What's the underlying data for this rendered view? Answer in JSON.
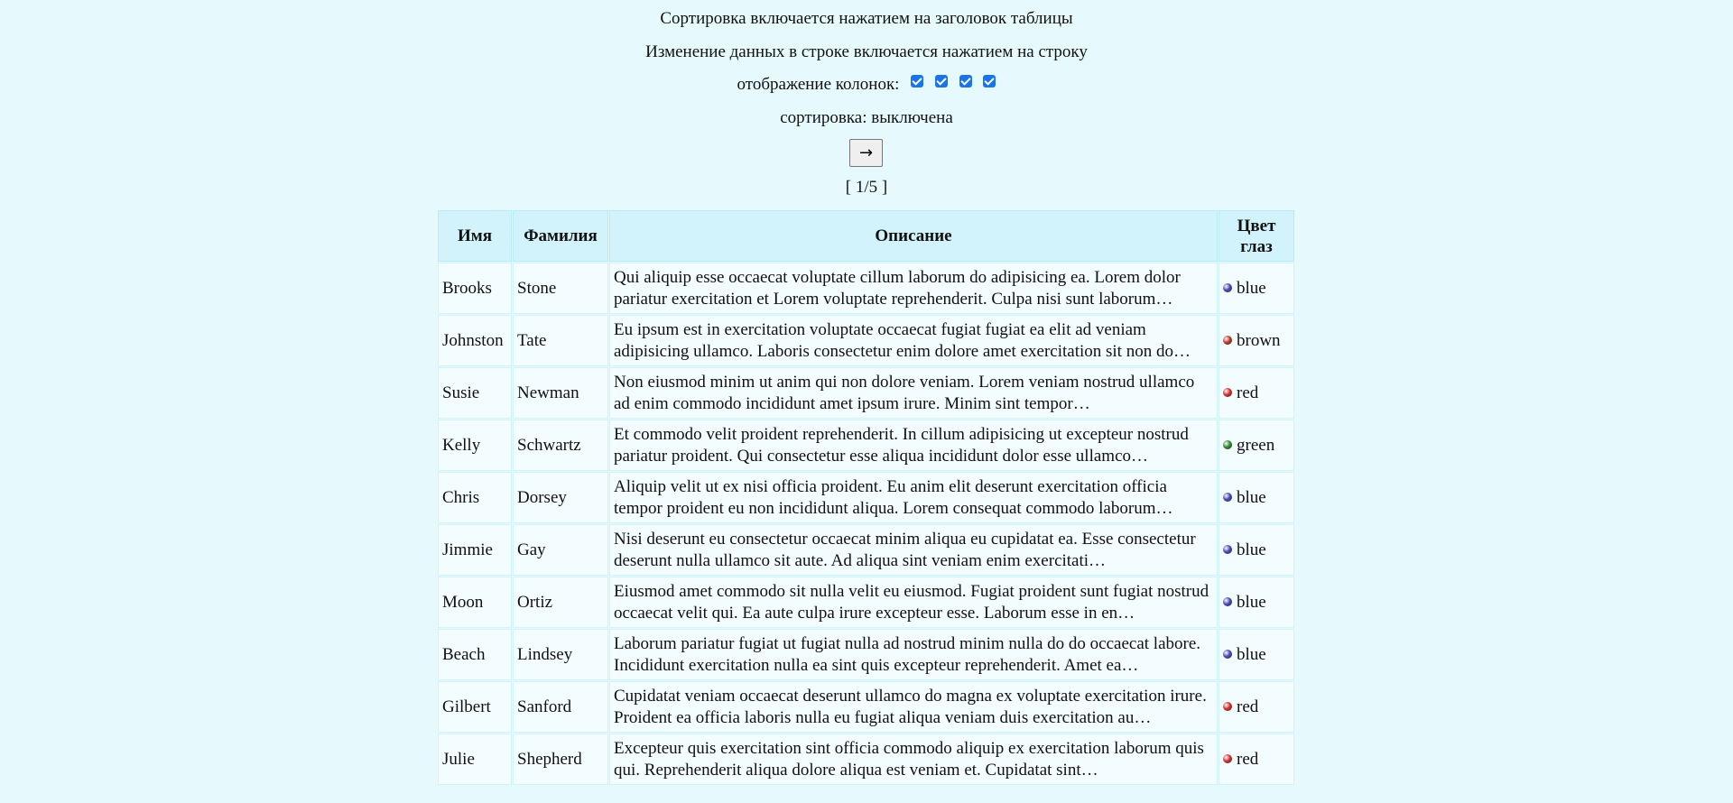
{
  "info": {
    "sort_hint": "Сортировка включается нажатием на заголовок таблицы",
    "edit_hint": "Изменение данных в строке включается нажатием на строку",
    "columns_label": "отображение колонок:",
    "sort_status": "сортировка: выключена"
  },
  "pager": {
    "next_label": "→",
    "page_indicator": "[ 1/5 ]"
  },
  "table": {
    "headers": [
      "Имя",
      "Фамилия",
      "Описание",
      "Цвет глаз"
    ],
    "rows": [
      {
        "first": "Brooks",
        "last": "Stone",
        "desc": "Qui aliquip esse occaecat voluptate cillum laborum do adipisicing ea. Lorem dolor pariatur exercitation et Lorem voluptate reprehenderit. Culpa nisi sunt laborum…",
        "eye": "blue"
      },
      {
        "first": "Johnston",
        "last": "Tate",
        "desc": "Eu ipsum est in exercitation voluptate occaecat fugiat fugiat ea elit ad veniam adipisicing ullamco. Laboris consectetur enim dolore amet exercitation sit non do…",
        "eye": "brown"
      },
      {
        "first": "Susie",
        "last": "Newman",
        "desc": "Non eiusmod minim ut anim qui non dolore veniam. Lorem veniam nostrud ullamco ad enim commodo incididunt amet ipsum irure. Minim sint tempor…",
        "eye": "red"
      },
      {
        "first": "Kelly",
        "last": "Schwartz",
        "desc": "Et commodo velit proident reprehenderit. In cillum adipisicing ut excepteur nostrud pariatur proident. Qui consectetur esse aliqua incididunt dolor esse ullamco…",
        "eye": "green"
      },
      {
        "first": "Chris",
        "last": "Dorsey",
        "desc": "Aliquip velit ut ex nisi officia proident. Eu anim elit deserunt exercitation officia tempor proident eu non incididunt aliqua. Lorem consequat commodo laborum…",
        "eye": "blue"
      },
      {
        "first": "Jimmie",
        "last": "Gay",
        "desc": "Nisi deserunt eu consectetur occaecat minim aliqua eu cupidatat ea. Esse consectetur deserunt nulla ullamco sit aute. Ad aliqua sint veniam enim exercitati…",
        "eye": "blue"
      },
      {
        "first": "Moon",
        "last": "Ortiz",
        "desc": "Eiusmod amet commodo sit nulla velit eu eiusmod. Fugiat proident sunt fugiat nostrud occaecat velit qui. Ea aute culpa irure excepteur esse. Laborum esse in en…",
        "eye": "blue"
      },
      {
        "first": "Beach",
        "last": "Lindsey",
        "desc": "Laborum pariatur fugiat ut fugiat nulla ad nostrud minim nulla do do occaecat labore. Incididunt exercitation nulla ea sint quis excepteur reprehenderit. Amet ea…",
        "eye": "blue"
      },
      {
        "first": "Gilbert",
        "last": "Sanford",
        "desc": "Cupidatat veniam occaecat deserunt ullamco do magna ex voluptate exercitation irure. Proident ea officia laboris nulla eu fugiat aliqua veniam duis exercitation au…",
        "eye": "red"
      },
      {
        "first": "Julie",
        "last": "Shepherd",
        "desc": "Excepteur quis exercitation sint officia commodo aliquip ex exercitation laborum quis qui. Reprehenderit aliqua dolore aliqua est veniam et. Cupidatat sint…",
        "eye": "red"
      }
    ]
  },
  "colors": {
    "background": "#e6fafe",
    "header_bg": "#d2f3fb",
    "checkbox": "#1a73e8",
    "eye_blue": "#4a4ab8",
    "eye_brown": "#c0392b",
    "eye_red": "#d63031",
    "eye_green": "#2e8b2e"
  }
}
